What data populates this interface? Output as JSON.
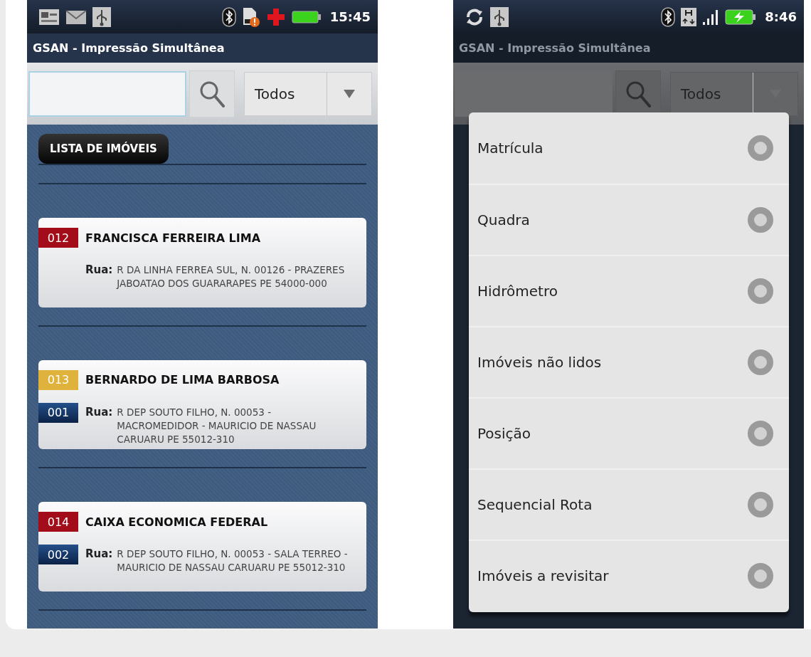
{
  "screens": [
    {
      "kind": "list",
      "status_bar": {
        "time": "15:45"
      },
      "title": "GSAN - Impressão Simultânea",
      "filter": {
        "value": "Todos"
      },
      "section_label": "LISTA DE IMÓVEIS",
      "items": [
        {
          "number": "012",
          "color": "#a30d19",
          "name": "FRANCISCA FERREIRA LIMA",
          "address_label": "Rua:",
          "address": "R DA LINHA FERREA SUL, N. 00126 - PRAZERES JABOATAO DOS GUARARAPES PE 54000-000"
        },
        {
          "number": "013",
          "color": "#dfb23c",
          "sub_number": "001",
          "name": "BERNARDO DE LIMA BARBOSA",
          "address_label": "Rua:",
          "address": "R DEP SOUTO FILHO, N. 00053 - MACROMEDIDOR - MAURICIO DE NASSAU CARUARU PE 55012-310"
        },
        {
          "number": "014",
          "color": "#a30d19",
          "sub_number": "002",
          "name": "CAIXA ECONOMICA FEDERAL",
          "address_label": "Rua:",
          "address": "R DEP SOUTO FILHO, N. 00053 - SALA TERREO - MAURICIO DE NASSAU CARUARU PE 55012-310"
        }
      ]
    },
    {
      "kind": "dialog",
      "status_bar": {
        "time": "8:46"
      },
      "title": "GSAN - Impressão Simultânea",
      "filter": {
        "value": "Todos"
      },
      "dialog": {
        "options": [
          {
            "label": "Matrícula",
            "selected": false
          },
          {
            "label": "Quadra",
            "selected": false
          },
          {
            "label": "Hidrômetro",
            "selected": false
          },
          {
            "label": "Imóveis não lidos",
            "selected": false
          },
          {
            "label": "Posição",
            "selected": false
          },
          {
            "label": "Sequencial Rota",
            "selected": false
          },
          {
            "label": "Imóveis a revisitar",
            "selected": false
          }
        ]
      }
    }
  ]
}
